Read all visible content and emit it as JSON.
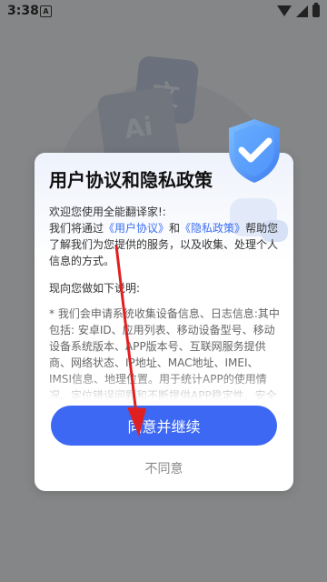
{
  "status_bar": {
    "time": "3:38",
    "notification_icon": "A"
  },
  "background_app": {
    "card_ai_text": "Ai",
    "card_wen_text": "文"
  },
  "dialog": {
    "title": "用户协议和隐私政策",
    "intro_greeting": "欢迎您使用全能翻译家!:",
    "intro_pre": "我们将通过",
    "link_user_agreement": "《用户协议》",
    "intro_and": "和",
    "link_privacy_policy": "《隐私政策》",
    "intro_post": "帮助您了解我们为您提供的服务，以及收集、处理个人信息的方式。",
    "section_heading": "现向您做如下说明:",
    "details": "* 我们会申请系统收集设备信息、日志信息:其中包括: 安卓ID、应用列表、移动设备型号、移动设备系统版本、APP版本号、互联网服务提供商、网络状态、IP地址、MAC地址、IMEI、IMSI信息、地理位置。用于统计APP的使用情况、定位错误问题和不断提供APP稳定性、安全性。",
    "agree_label": "同意并继续",
    "disagree_label": "不同意"
  },
  "colors": {
    "primary": "#3c68f3",
    "link": "#3b6ff5",
    "annotation": "#e02020"
  },
  "icons": [
    "shield-check-icon",
    "wifi-icon",
    "signal-icon",
    "battery-icon",
    "notification-icon"
  ]
}
